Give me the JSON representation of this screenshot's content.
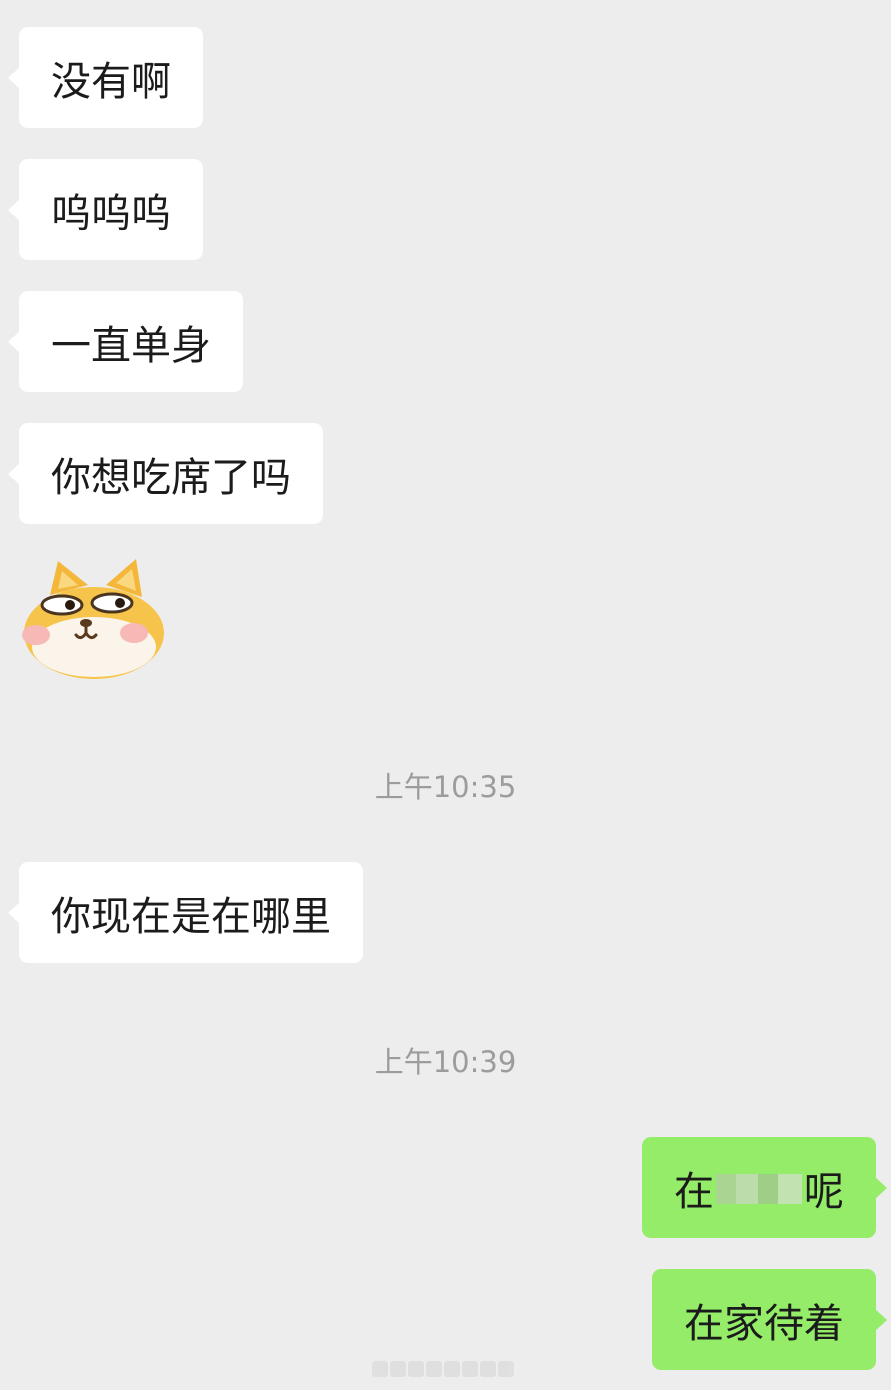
{
  "chat": {
    "messages": [
      {
        "side": "in",
        "text": "没有啊"
      },
      {
        "side": "in",
        "text": "呜呜呜"
      },
      {
        "side": "in",
        "text": "一直单身"
      },
      {
        "side": "in",
        "text": "你想吃席了吗"
      },
      {
        "side": "in",
        "type": "sticker",
        "icon": "shiba-dog-side-eye-sticker"
      },
      {
        "type": "timestamp",
        "text": "上午10:35"
      },
      {
        "side": "in",
        "text": "你现在是在哪里"
      },
      {
        "type": "timestamp",
        "text": "上午10:39"
      },
      {
        "side": "out",
        "text_before": "在",
        "text_after": "呢",
        "censored": true
      },
      {
        "side": "out",
        "text": "在家待着"
      }
    ]
  },
  "colors": {
    "background": "#ededed",
    "incoming_bubble": "#ffffff",
    "outgoing_bubble": "#95ec69",
    "timestamp_text": "#9c9c9c"
  }
}
